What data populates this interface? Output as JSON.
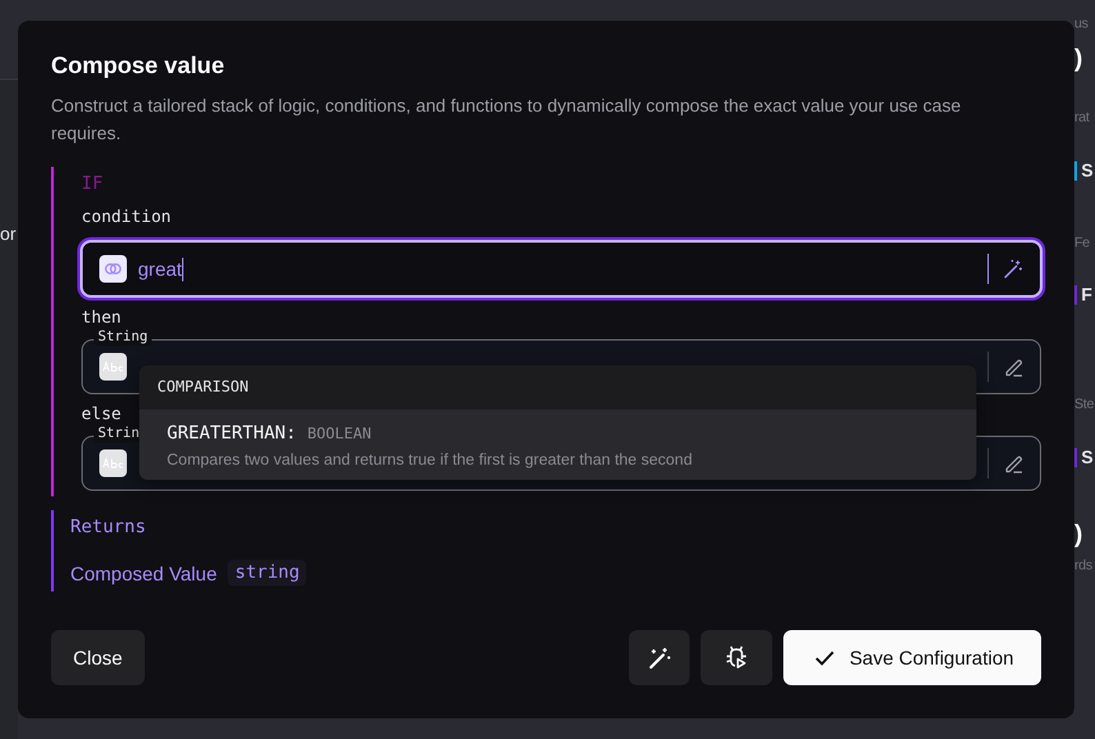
{
  "background": {
    "left_fragments": [
      {
        "text": "or"
      }
    ],
    "right_fragments": [
      {
        "text": "us",
        "kind": "label"
      },
      {
        "text": ")",
        "kind": "big"
      },
      {
        "text": "rat",
        "kind": "label"
      },
      {
        "text": "S",
        "kind": "item",
        "color": "#0ea5e9"
      },
      {
        "text": "Fe",
        "kind": "label"
      },
      {
        "text": "F",
        "kind": "item",
        "color": "#6d28d9"
      },
      {
        "text": "Ste",
        "kind": "label"
      },
      {
        "text": "S",
        "kind": "item",
        "color": "#6d28d9"
      },
      {
        "text": ")",
        "kind": "big"
      },
      {
        "text": "rds",
        "kind": "label"
      }
    ]
  },
  "dialog": {
    "title": "Compose value",
    "description": "Construct a tailored stack of logic, conditions, and functions to dynamically compose the exact value your use case requires.",
    "if_block": {
      "keyword": "IF",
      "fields": [
        {
          "label": "condition",
          "kind": "function",
          "value": "great",
          "focused": true
        },
        {
          "label": "then",
          "kind": "static",
          "type_label": "String",
          "focused": false
        },
        {
          "label": "else",
          "kind": "static",
          "type_label": "Strin",
          "focused": false
        }
      ]
    },
    "suggestions": {
      "group": "COMPARISON",
      "items": [
        {
          "name": "GREATERTHAN:",
          "type": "BOOLEAN",
          "description": "Compares two values and returns true if the first is greater than the second",
          "selected": true
        }
      ]
    },
    "returns": {
      "heading": "Returns",
      "label": "Composed Value",
      "type": "string"
    },
    "buttons": {
      "close": "Close",
      "save": "Save Configuration"
    }
  }
}
